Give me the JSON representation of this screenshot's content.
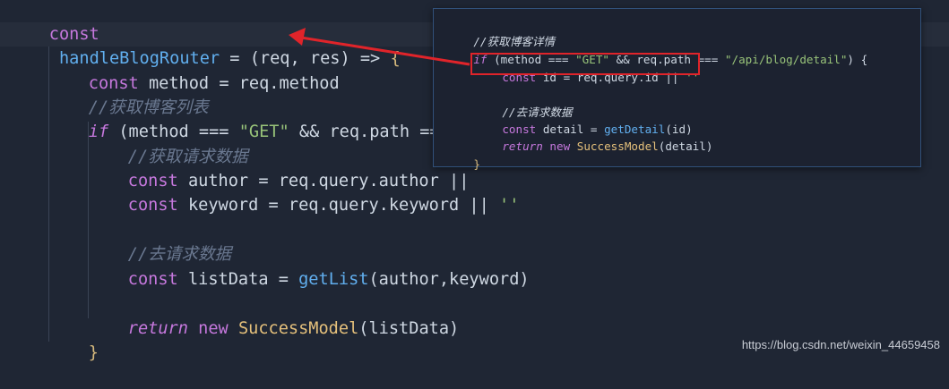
{
  "main_code": {
    "l1": {
      "kw": "const",
      "name": "handleBlogRouter",
      "eq": " = (",
      "p1": "req",
      "comma": ", ",
      "p2": "res",
      "arrow": ") => ",
      "brace": "{"
    },
    "l3": {
      "kw": "const",
      "rest": " method = req.method"
    },
    "l4": {
      "comment": "//获取博客列表"
    },
    "l5": {
      "kw": "if",
      "rest": " (method === ",
      "str": "\"GET\"",
      "rest2": " && req.path === \"/"
    },
    "l6": {
      "comment": "//获取请求数据"
    },
    "l7": {
      "kw": "const",
      "rest": " author = req.query.author ||"
    },
    "l8": {
      "kw": "const",
      "rest": " keyword = req.query.keyword || ",
      "str": "''"
    },
    "l10": {
      "comment": "//去请求数据"
    },
    "l11": {
      "kw": "const",
      "rest": " listData = ",
      "fn": "getList",
      "args": "(author,keyword)"
    },
    "l13": {
      "kw1": "return",
      "kw2": " new ",
      "cls": "SuccessModel",
      "args": "(listData)"
    },
    "l14": {
      "brace": "}"
    }
  },
  "popup_code": {
    "p1": {
      "comment": "//获取博客详情"
    },
    "p2": {
      "kw": "if",
      "rest": " (method === ",
      "str1": "\"GET\"",
      "rest2": " && req.path === ",
      "str2": "\"/api/blog/detail\"",
      "rest3": ") {"
    },
    "p3": {
      "kw": "const",
      "rest": " id = req.query.id || ",
      "str": "''"
    },
    "p5": {
      "comment": "//去请求数据"
    },
    "p6": {
      "kw": "const",
      "rest": " detail = ",
      "fn": "getDetail",
      "args": "(id)"
    },
    "p7": {
      "kw1": "return",
      "kw2": " new ",
      "cls": "SuccessModel",
      "args": "(detail)"
    },
    "p8": {
      "brace": "}"
    }
  },
  "watermark": "https://blog.csdn.net/weixin_44659458",
  "colors": {
    "background": "#1f2634",
    "keyword": "#c678dd",
    "function": "#61afef",
    "string": "#98c379",
    "class": "#e5c07b",
    "comment": "#6a7890",
    "annotation": "#e0242a"
  }
}
